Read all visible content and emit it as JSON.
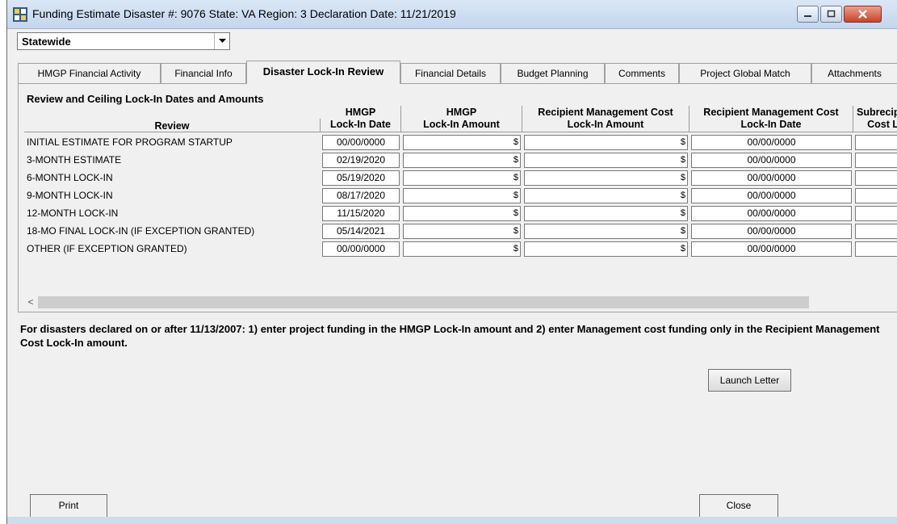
{
  "window": {
    "title": "Funding Estimate  Disaster #: 9076  State: VA  Region: 3  Declaration Date: 11/21/2019"
  },
  "scope_select": {
    "value": "Statewide"
  },
  "tabs": [
    {
      "label": "HMGP Financial Activity",
      "active": false
    },
    {
      "label": "Financial Info",
      "active": false
    },
    {
      "label": "Disaster Lock-In Review",
      "active": true
    },
    {
      "label": "Financial Details",
      "active": false
    },
    {
      "label": "Budget Planning",
      "active": false
    },
    {
      "label": "Comments",
      "active": false
    },
    {
      "label": "Project Global Match",
      "active": false
    },
    {
      "label": "Attachments",
      "active": false
    }
  ],
  "grid": {
    "section_title": "Review and Ceiling Lock-In Dates and Amounts",
    "columns": {
      "review": "Review",
      "hmgp_date_1": "HMGP",
      "hmgp_date_2": "Lock-In Date",
      "hmgp_amount_1": "HMGP",
      "hmgp_amount_2": "Lock-In Amount",
      "rmc_amount_1": "Recipient Management Cost",
      "rmc_amount_2": "Lock-In Amount",
      "rmc_date_1": "Recipient Management Cost",
      "rmc_date_2": "Lock-In Date",
      "sub_1": "Subrecip",
      "sub_2": "Cost L"
    },
    "currency_symbol": "$",
    "rows": [
      {
        "review": "INITIAL ESTIMATE FOR PROGRAM STARTUP",
        "hmgp_date": "00/00/0000",
        "rmc_date": "00/00/0000"
      },
      {
        "review": "3-MONTH ESTIMATE",
        "hmgp_date": "02/19/2020",
        "rmc_date": "00/00/0000"
      },
      {
        "review": "6-MONTH LOCK-IN",
        "hmgp_date": "05/19/2020",
        "rmc_date": "00/00/0000"
      },
      {
        "review": "9-MONTH LOCK-IN",
        "hmgp_date": "08/17/2020",
        "rmc_date": "00/00/0000"
      },
      {
        "review": "12-MONTH LOCK-IN",
        "hmgp_date": "11/15/2020",
        "rmc_date": "00/00/0000"
      },
      {
        "review": "18-MO FINAL LOCK-IN (IF EXCEPTION GRANTED)",
        "hmgp_date": "05/14/2021",
        "rmc_date": "00/00/0000"
      },
      {
        "review": "OTHER (IF EXCEPTION GRANTED)",
        "hmgp_date": "00/00/0000",
        "rmc_date": "00/00/0000"
      }
    ]
  },
  "note": "For disasters declared on or after 11/13/2007: 1) enter project funding in the HMGP Lock-In amount and 2) enter Management cost funding only in the Recipient Management Cost Lock-In amount.",
  "buttons": {
    "launch_letter": "Launch Letter",
    "print": "Print",
    "close": "Close"
  }
}
